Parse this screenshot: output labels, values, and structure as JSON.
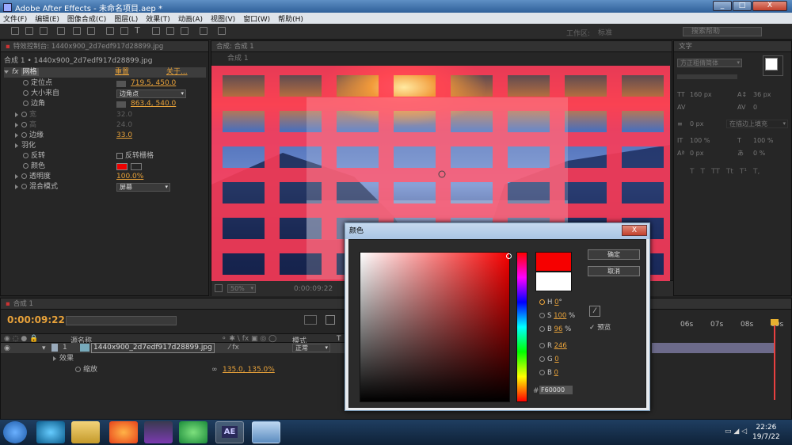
{
  "window": {
    "title": "Adobe After Effects - 未命名项目.aep *",
    "min": "_",
    "max": "□",
    "close": "X"
  },
  "menu": [
    "文件(F)",
    "编辑(E)",
    "图像合成(C)",
    "图层(L)",
    "效果(T)",
    "动画(A)",
    "视图(V)",
    "窗口(W)",
    "帮助(H)"
  ],
  "toolbar": {
    "workspace_label": "工作区:",
    "workspace_value": "标准",
    "search_placeholder": "搜索帮助"
  },
  "effect_controls": {
    "tab": "特效控制台: 1440x900_2d7edf917d28899.jpg",
    "subtitle": "合成 1 • 1440x900_2d7edf917d28899.jpg",
    "effect_name": "网格",
    "reset": "重置",
    "about": "关于...",
    "props": [
      {
        "label": "定位点",
        "value": "719.5, 450.0"
      },
      {
        "label": "大小来自",
        "value": "边角点"
      },
      {
        "label": "边角",
        "value": "863.4, 540.0"
      },
      {
        "label": "宽",
        "value": "32.0"
      },
      {
        "label": "高",
        "value": "24.0"
      },
      {
        "label": "边缘",
        "value": "33.0"
      },
      {
        "label": "羽化",
        "value": ""
      },
      {
        "label": "反转",
        "value": "反转栅格"
      },
      {
        "label": "颜色",
        "value": ""
      },
      {
        "label": "透明度",
        "value": "100.0%"
      },
      {
        "label": "混合模式",
        "value": "屏幕"
      }
    ]
  },
  "composition": {
    "tab": "合成: 合成 1",
    "subtab": "合成 1",
    "zoom": "50%",
    "time": "0:00:09:22"
  },
  "character": {
    "tab": "文字",
    "font": "方正粗倩简体",
    "size": "160 px",
    "leading": "36 px",
    "tracking": "0",
    "stroke": "0 px",
    "stroke_mode": "在描边上填充",
    "vscale": "100 %",
    "hscale": "100 %",
    "baseline": "0 px",
    "tsume": "0 %",
    "styles": [
      "T",
      "T",
      "TT",
      "Tt",
      "T¹",
      "T,"
    ]
  },
  "timeline": {
    "tab": "合成 1",
    "time": "0:00:09:22",
    "headers": {
      "layer_name": "源名称",
      "mode": "模式",
      "t": "T"
    },
    "layer": {
      "num": "1",
      "name": "1440x900_2d7edf917d28899.jpg",
      "mode": "正常"
    },
    "effects_label": "效果",
    "scale_label": "缩放",
    "scale_value": "135.0, 135.0%",
    "ruler": [
      "06s",
      "07s",
      "08s",
      "09s"
    ]
  },
  "color_dialog": {
    "title": "颜色",
    "ok": "确定",
    "cancel": "取消",
    "preview": "预览",
    "fields": [
      {
        "label": "H",
        "value": "0",
        "unit": "°"
      },
      {
        "label": "S",
        "value": "100",
        "unit": "%"
      },
      {
        "label": "B",
        "value": "96",
        "unit": "%"
      },
      {
        "label": "R",
        "value": "246",
        "unit": ""
      },
      {
        "label": "G",
        "value": "0",
        "unit": ""
      },
      {
        "label": "B",
        "value": "0",
        "unit": ""
      }
    ],
    "hex_label": "#",
    "hex": "F60000",
    "new_color": "#f60000",
    "old_color": "#ffffff"
  },
  "taskbar": {
    "time": "22:26",
    "date": "19/7/22"
  }
}
